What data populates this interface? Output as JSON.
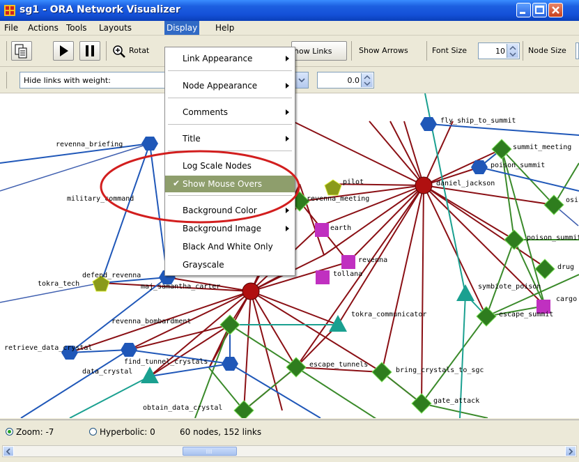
{
  "window": {
    "title": "sg1 - ORA Network Visualizer"
  },
  "menubar": [
    "File",
    "Actions",
    "Tools",
    "Layouts",
    "Display",
    "Help"
  ],
  "toolbar": {
    "rotate_label": "Rotat",
    "show_links_label": "how Links",
    "show_arrows_label": "Show Arrows",
    "font_size_label": "Font Size",
    "font_size_value": "10",
    "node_size_label": "Node Size"
  },
  "filterbar": {
    "hide_links_label": "Hide links with weight:",
    "weight_value": "0.0"
  },
  "display_menu": {
    "items": [
      {
        "label": "Link Appearance",
        "submenu": true
      },
      {
        "label": "Node Appearance",
        "submenu": true
      },
      {
        "label": "Comments",
        "submenu": true
      },
      {
        "label": "Title",
        "submenu": true
      },
      {
        "label": "Log Scale Nodes",
        "submenu": false
      },
      {
        "label": "Show Mouse Overs",
        "submenu": false,
        "checked": true,
        "highlighted": true
      },
      {
        "label": "Background Color",
        "submenu": true
      },
      {
        "label": "Background Image",
        "submenu": true
      },
      {
        "label": "Black And White Only",
        "submenu": false
      },
      {
        "label": "Grayscale",
        "submenu": false
      }
    ]
  },
  "graph": {
    "labels": [
      "revenna_briefing",
      "military_command",
      "tokra_tech",
      "defend_revenna",
      "maj_samantha_carter",
      "revenna_bombardment",
      "retrieve_data_crystal",
      "data_crystal",
      "find_tunnel_crystals",
      "obtain_data_crystal",
      "escape_tunnels",
      "bring_crystals_to_sgc",
      "gate_attack",
      "tokra_communicator",
      "symbiote_poison",
      "escape_summit",
      "cargo",
      "drug",
      "poison_summit",
      "osi",
      "summit_meeting",
      "poison_summit",
      "daniel_jackson",
      "fly_ship_to_summit",
      "pilot",
      "revenna_meeting",
      "earth",
      "revenna",
      "tollana"
    ]
  },
  "statusbar": {
    "zoom_label": "Zoom: -7",
    "hyperbolic_label": "Hyperbolic: 0",
    "counts": "60 nodes, 152 links"
  },
  "colors": {
    "titlebar": "#1450d8",
    "menu_highlight": "#316ac5",
    "item_highlight": "#8e9e6c",
    "annotation": "#d21e1e",
    "agent_node": "#1f57b8",
    "task_node": "#2e7d1e",
    "resource_node": "#c030c0",
    "knowledge_node": "#1aa090",
    "event_node": "#8a9a1a",
    "central_node": "#b01010"
  }
}
